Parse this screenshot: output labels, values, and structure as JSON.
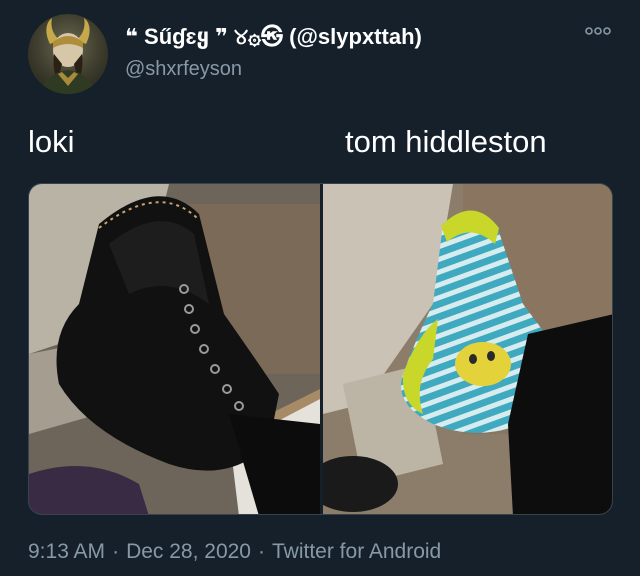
{
  "author": {
    "display_name": "❝ Sűɠɛყ ❞ ୪۞㉿ (@slypxttah)",
    "username": "@shxrfeyson",
    "avatar_icon": "avatar-portrait"
  },
  "tweet": {
    "left_label": "loki",
    "right_label": "tom hiddleston",
    "media_left_desc": "black lace-up boot",
    "media_right_desc": "striped yellow and blue sock"
  },
  "footer": {
    "time": "9:13 AM",
    "date": "Dec 28, 2020",
    "source": "Twitter for Android",
    "separator": "·"
  },
  "icons": {
    "more": "more-icon"
  },
  "colors": {
    "background": "#15202b",
    "text": "#ffffff",
    "secondary": "#8899a6",
    "border": "#38444d"
  }
}
